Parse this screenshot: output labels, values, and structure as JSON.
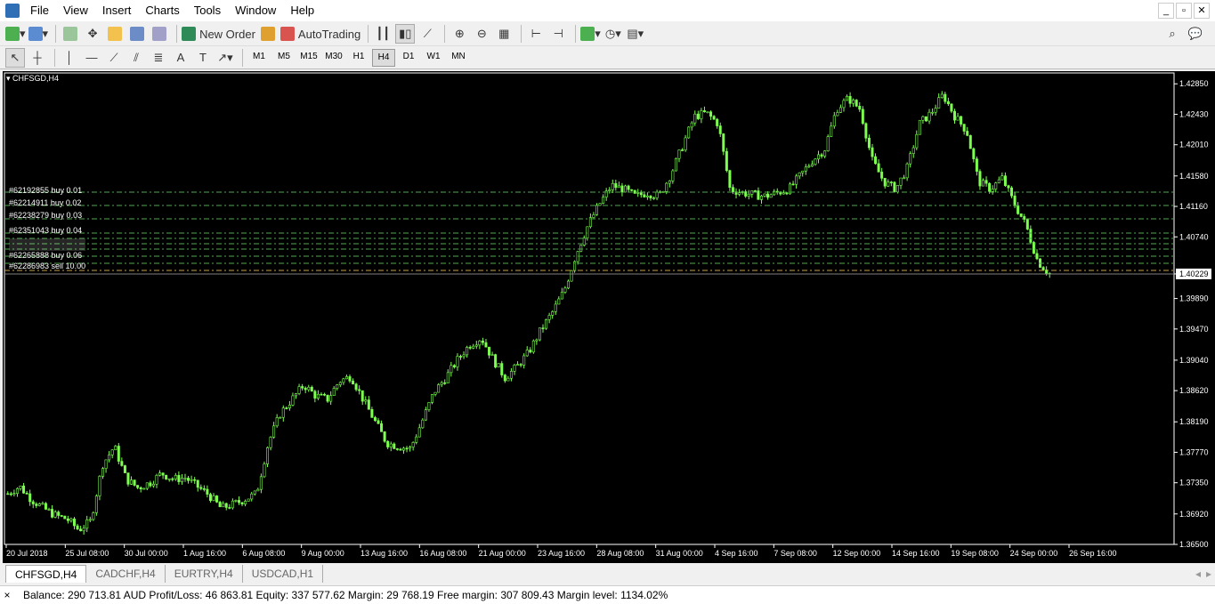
{
  "menu": {
    "items": [
      "File",
      "View",
      "Insert",
      "Charts",
      "Tools",
      "Window",
      "Help"
    ]
  },
  "toolbar": {
    "new_order_label": "New Order",
    "autotrading_label": "AutoTrading",
    "timeframes": [
      "M1",
      "M5",
      "M15",
      "M30",
      "H1",
      "H4",
      "D1",
      "W1",
      "MN"
    ],
    "selected_timeframe": "H4"
  },
  "chart": {
    "title": "CHFSGD,H4",
    "current_price_label": "1.40229"
  },
  "chart_data": {
    "type": "candlestick",
    "symbol": "CHFSGD",
    "timeframe": "H4",
    "y_ticks": [
      "1.42850",
      "1.42430",
      "1.42010",
      "1.41580",
      "1.41160",
      "1.40740",
      "1.40229",
      "1.39890",
      "1.39470",
      "1.39040",
      "1.38620",
      "1.38190",
      "1.37770",
      "1.37350",
      "1.36920",
      "1.36500"
    ],
    "x_ticks": [
      "20 Jul 2018",
      "25 Jul 08:00",
      "30 Jul 00:00",
      "1 Aug 16:00",
      "6 Aug 08:00",
      "9 Aug 00:00",
      "13 Aug 16:00",
      "16 Aug 08:00",
      "21 Aug 00:00",
      "23 Aug 16:00",
      "28 Aug 08:00",
      "31 Aug 00:00",
      "4 Sep 16:00",
      "7 Sep 08:00",
      "12 Sep 00:00",
      "14 Sep 16:00",
      "19 Sep 08:00",
      "24 Sep 00:00",
      "26 Sep 16:00"
    ],
    "ylim": [
      1.365,
      1.43
    ],
    "close_path": [
      1.372,
      1.373,
      1.3712,
      1.37,
      1.369,
      1.3685,
      1.367,
      1.3682,
      1.376,
      1.3785,
      1.374,
      1.3728,
      1.3735,
      1.3748,
      1.374,
      1.3742,
      1.373,
      1.3718,
      1.37,
      1.3705,
      1.3712,
      1.372,
      1.379,
      1.383,
      1.385,
      1.387,
      1.3855,
      1.385,
      1.3875,
      1.3882,
      1.385,
      1.382,
      1.379,
      1.3785,
      1.3782,
      1.382,
      1.386,
      1.388,
      1.3905,
      1.3925,
      1.3935,
      1.3905,
      1.388,
      1.3895,
      1.3915,
      1.3945,
      1.397,
      1.4,
      1.405,
      1.409,
      1.412,
      1.4145,
      1.414,
      1.413,
      1.4135,
      1.413,
      1.416,
      1.42,
      1.424,
      1.4245,
      1.423,
      1.414,
      1.4135,
      1.4132,
      1.413,
      1.4135,
      1.414,
      1.416,
      1.418,
      1.4195,
      1.425,
      1.4265,
      1.425,
      1.418,
      1.415,
      1.414,
      1.417,
      1.423,
      1.4245,
      1.427,
      1.424,
      1.422,
      1.415,
      1.414,
      1.4155,
      1.412,
      1.409,
      1.404,
      1.4023
    ],
    "lines": [
      {
        "label": "#62192855 buy 0.01"
      },
      {
        "label": "#62214911 buy 0.02"
      },
      {
        "label": "#62238279 buy 0.03"
      },
      {
        "label": "#62351043 buy 0.04"
      },
      {
        "label": "#62265888 buy 0.06"
      },
      {
        "label": "#62286983 sell 10.00"
      }
    ]
  },
  "tabs": [
    "CHFSGD,H4",
    "CADCHF,H4",
    "EURTRY,H4",
    "USDCAD,H1"
  ],
  "status": {
    "text": "Balance: 290 713.81 AUD  Profit/Loss: 46 863.81  Equity: 337 577.62  Margin: 29 768.19  Free margin: 307 809.43  Margin level: 1134.02%"
  },
  "colors": {
    "candle": "#7cff4f",
    "level_line": "#4fa84f",
    "price_line": "#808080"
  }
}
